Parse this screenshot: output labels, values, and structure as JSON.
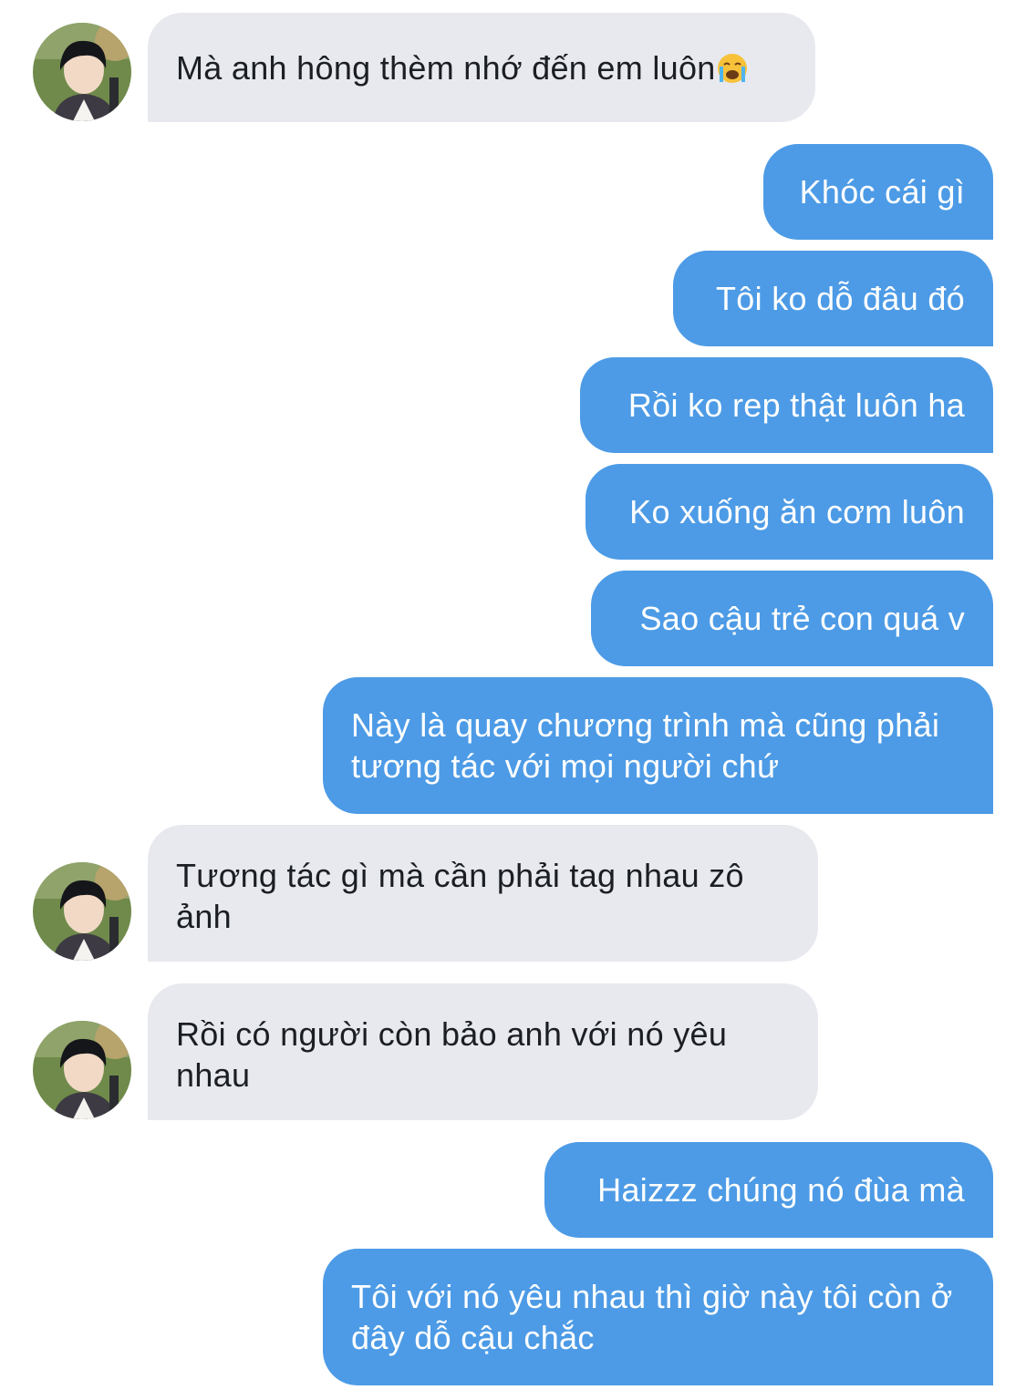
{
  "conversation": {
    "messages": [
      {
        "direction": "incoming",
        "text": "Mà anh hông thèm nhớ đến em luôn",
        "emoji": "loudly-crying-face-emoji"
      },
      {
        "direction": "outgoing",
        "text": "Khóc cái gì"
      },
      {
        "direction": "outgoing",
        "text": "Tôi ko dỗ đâu đó"
      },
      {
        "direction": "outgoing",
        "text": "Rồi ko rep thật luôn ha"
      },
      {
        "direction": "outgoing",
        "text": "Ko xuống ăn cơm luôn"
      },
      {
        "direction": "outgoing",
        "text": "Sao cậu trẻ con quá v"
      },
      {
        "direction": "outgoing",
        "text": "Này là quay chương trình mà cũng phải tương tác với mọi người chứ"
      },
      {
        "direction": "incoming",
        "text": "Tương tác gì mà cần phải tag nhau zô ảnh"
      },
      {
        "direction": "incoming",
        "text": "Rồi có người còn bảo anh với nó yêu nhau"
      },
      {
        "direction": "outgoing",
        "text": "Haizzz chúng nó đùa mà"
      },
      {
        "direction": "outgoing",
        "text": "Tôi với nó yêu nhau thì giờ này tôi còn ở đây dỗ cậu chắc"
      }
    ]
  },
  "colors": {
    "incoming_bubble": "#e7e9ee",
    "incoming_text": "#1b1f24",
    "outgoing_bubble": "#4d9be6",
    "outgoing_text": "#ffffff",
    "background": "#ffffff"
  },
  "icons": {
    "avatar": "contact-avatar-photo",
    "emoji": "loudly-crying-face-emoji"
  }
}
